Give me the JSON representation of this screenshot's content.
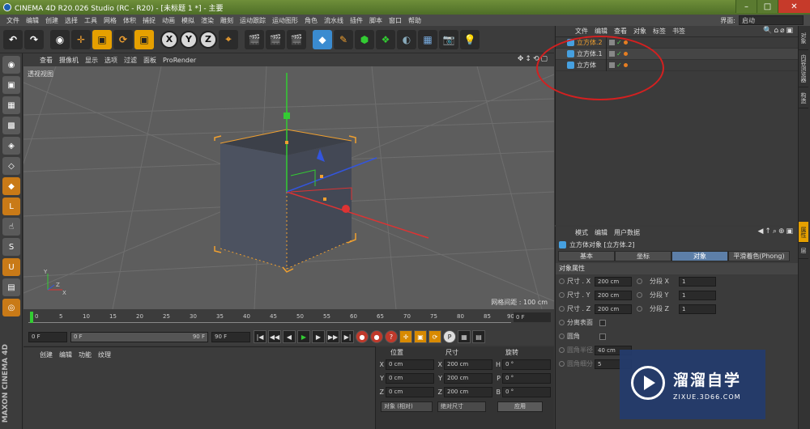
{
  "window": {
    "title": "CINEMA 4D R20.026 Studio (RC - R20) - [未标题 1 *] - 主要"
  },
  "menu": [
    "文件",
    "编辑",
    "创建",
    "选择",
    "工具",
    "网格",
    "体积",
    "捕捉",
    "动画",
    "模拟",
    "渲染",
    "雕刻",
    "运动跟踪",
    "运动图形",
    "角色",
    "流水线",
    "插件",
    "脚本",
    "窗口",
    "帮助"
  ],
  "layout": {
    "label": "界面:",
    "value": "启动"
  },
  "toolbar": {
    "axes": [
      "X",
      "Y",
      "Z"
    ]
  },
  "viewport": {
    "menu": [
      "查看",
      "摄像机",
      "显示",
      "选项",
      "过滤",
      "面板",
      "ProRender"
    ],
    "name": "透视视图",
    "grid_label": "网格间距 : 100 cm"
  },
  "timeline": {
    "ticks": [
      "0",
      "5",
      "10",
      "15",
      "20",
      "25",
      "30",
      "35",
      "40",
      "45",
      "50",
      "55",
      "60",
      "65",
      "70",
      "75",
      "80",
      "85",
      "90"
    ],
    "frame_field": "0 F"
  },
  "playback": {
    "start": "0 F",
    "range_start": "0 F",
    "range_end": "90 F",
    "end": "90 F"
  },
  "material": {
    "menu": [
      "创建",
      "编辑",
      "功能",
      "纹理"
    ]
  },
  "coords": {
    "headers": [
      "位置",
      "尺寸",
      "旋转"
    ],
    "rows": [
      {
        "axis": "X",
        "pos": "0 cm",
        "size_axis": "X",
        "size": "200 cm",
        "rot_axis": "H",
        "rot": "0 °"
      },
      {
        "axis": "Y",
        "pos": "0 cm",
        "size_axis": "Y",
        "size": "200 cm",
        "rot_axis": "P",
        "rot": "0 °"
      },
      {
        "axis": "Z",
        "pos": "0 cm",
        "size_axis": "Z",
        "size": "200 cm",
        "rot_axis": "B",
        "rot": "0 °"
      }
    ],
    "mode": "对象 (相对)",
    "size_mode": "绝对尺寸",
    "apply": "应用"
  },
  "objects": {
    "menu": [
      "文件",
      "编辑",
      "查看",
      "对象",
      "标签",
      "书签"
    ],
    "items": [
      "立方体.2",
      "立方体.1",
      "立方体"
    ]
  },
  "attributes": {
    "menu": [
      "模式",
      "编辑",
      "用户数据"
    ],
    "title": "立方体对象 [立方体.2]",
    "tabs": [
      "基本",
      "坐标",
      "对象",
      "平滑着色(Phong)"
    ],
    "section": "对象属性",
    "rows": [
      {
        "label": "尺寸 . X",
        "value": "200 cm",
        "seg_label": "分段 X",
        "seg": "1"
      },
      {
        "label": "尺寸 . Y",
        "value": "200 cm",
        "seg_label": "分段 Y",
        "seg": "1"
      },
      {
        "label": "尺寸 . Z",
        "value": "200 cm",
        "seg_label": "分段 Z",
        "seg": "1"
      }
    ],
    "separate": "分离表面",
    "fillet": "圆角",
    "fillet_radius": "圆角半径",
    "fillet_radius_val": "40 cm",
    "fillet_sub": "圆角细分",
    "fillet_sub_val": "5"
  },
  "sidetabs": [
    "对象",
    "内容浏览器",
    "构造",
    "属性",
    "层"
  ],
  "watermark": {
    "title": "溜溜自学",
    "url": "ZIXUE.3D66.COM"
  },
  "brand": "MAXON CINEMA 4D"
}
